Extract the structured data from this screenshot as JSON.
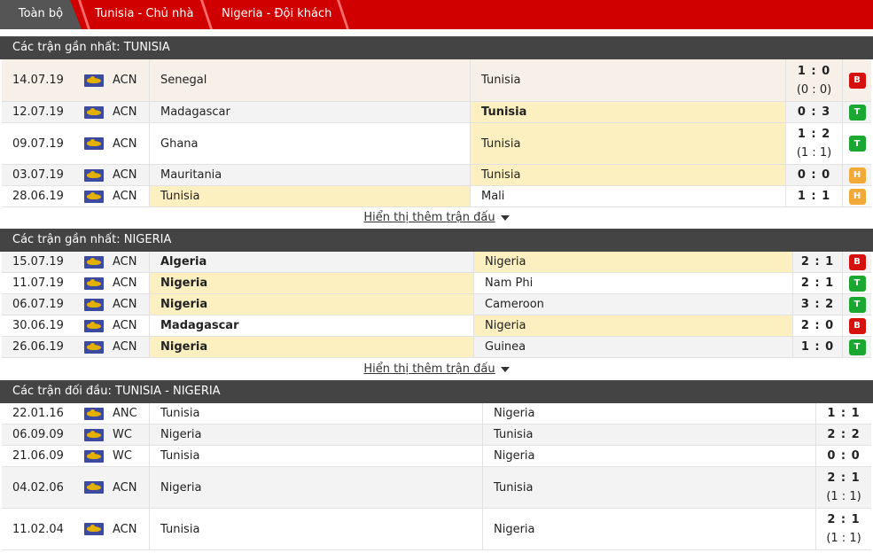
{
  "tabs": [
    {
      "label": "Toàn bộ"
    },
    {
      "label": "Tunisia - Chủ nhà"
    },
    {
      "label": "Nigeria - Đội khách"
    }
  ],
  "colors": {
    "tab_bar": "#d10000",
    "header": "#444444",
    "highlight": "#fcefc0",
    "win": "#1aa833",
    "lose": "#d60f0f",
    "draw": "#f2a93a"
  },
  "sections": [
    {
      "title": "Các trận gần nhất: TUNISIA",
      "more_label": "Hiển thị thêm trận đấu",
      "rows": [
        {
          "date": "14.07.19",
          "comp": "ACN",
          "home": "Senegal",
          "away": "Tunisia",
          "score": "1 : 0",
          "ht": "(0 : 0)",
          "result": "B"
        },
        {
          "date": "12.07.19",
          "comp": "ACN",
          "home": "Madagascar",
          "away": "Tunisia",
          "score": "0 : 3",
          "ht": "",
          "result": "T"
        },
        {
          "date": "09.07.19",
          "comp": "ACN",
          "home": "Ghana",
          "away": "Tunisia",
          "score": "1 : 2",
          "ht": "(1 : 1)",
          "result": "T"
        },
        {
          "date": "03.07.19",
          "comp": "ACN",
          "home": "Mauritania",
          "away": "Tunisia",
          "score": "0 : 0",
          "ht": "",
          "result": "H"
        },
        {
          "date": "28.06.19",
          "comp": "ACN",
          "home": "Tunisia",
          "away": "Mali",
          "score": "1 : 1",
          "ht": "",
          "result": "H"
        }
      ]
    },
    {
      "title": "Các trận gần nhất: NIGERIA",
      "more_label": "Hiển thị thêm trận đấu",
      "rows": [
        {
          "date": "15.07.19",
          "comp": "ACN",
          "home": "Algeria",
          "away": "Nigeria",
          "score": "2 : 1",
          "ht": "",
          "result": "B"
        },
        {
          "date": "11.07.19",
          "comp": "ACN",
          "home": "Nigeria",
          "away": "Nam Phi",
          "score": "2 : 1",
          "ht": "",
          "result": "T"
        },
        {
          "date": "06.07.19",
          "comp": "ACN",
          "home": "Nigeria",
          "away": "Cameroon",
          "score": "3 : 2",
          "ht": "",
          "result": "T"
        },
        {
          "date": "30.06.19",
          "comp": "ACN",
          "home": "Madagascar",
          "away": "Nigeria",
          "score": "2 : 0",
          "ht": "",
          "result": "B"
        },
        {
          "date": "26.06.19",
          "comp": "ACN",
          "home": "Nigeria",
          "away": "Guinea",
          "score": "1 : 0",
          "ht": "",
          "result": "T"
        }
      ]
    },
    {
      "title": "Các trận đối đầu: TUNISIA - NIGERIA",
      "rows": [
        {
          "date": "22.01.16",
          "comp": "ANC",
          "home": "Tunisia",
          "away": "Nigeria",
          "score": "1 : 1",
          "ht": ""
        },
        {
          "date": "06.09.09",
          "comp": "WC",
          "home": "Nigeria",
          "away": "Tunisia",
          "score": "2 : 2",
          "ht": ""
        },
        {
          "date": "21.06.09",
          "comp": "WC",
          "home": "Tunisia",
          "away": "Nigeria",
          "score": "0 : 0",
          "ht": ""
        },
        {
          "date": "04.02.06",
          "comp": "ACN",
          "home": "Nigeria",
          "away": "Tunisia",
          "score": "2 : 1",
          "ht": "(1 : 1)"
        },
        {
          "date": "11.02.04",
          "comp": "ACN",
          "home": "Tunisia",
          "away": "Nigeria",
          "score": "2 : 1",
          "ht": "(1 : 1)"
        }
      ]
    }
  ]
}
